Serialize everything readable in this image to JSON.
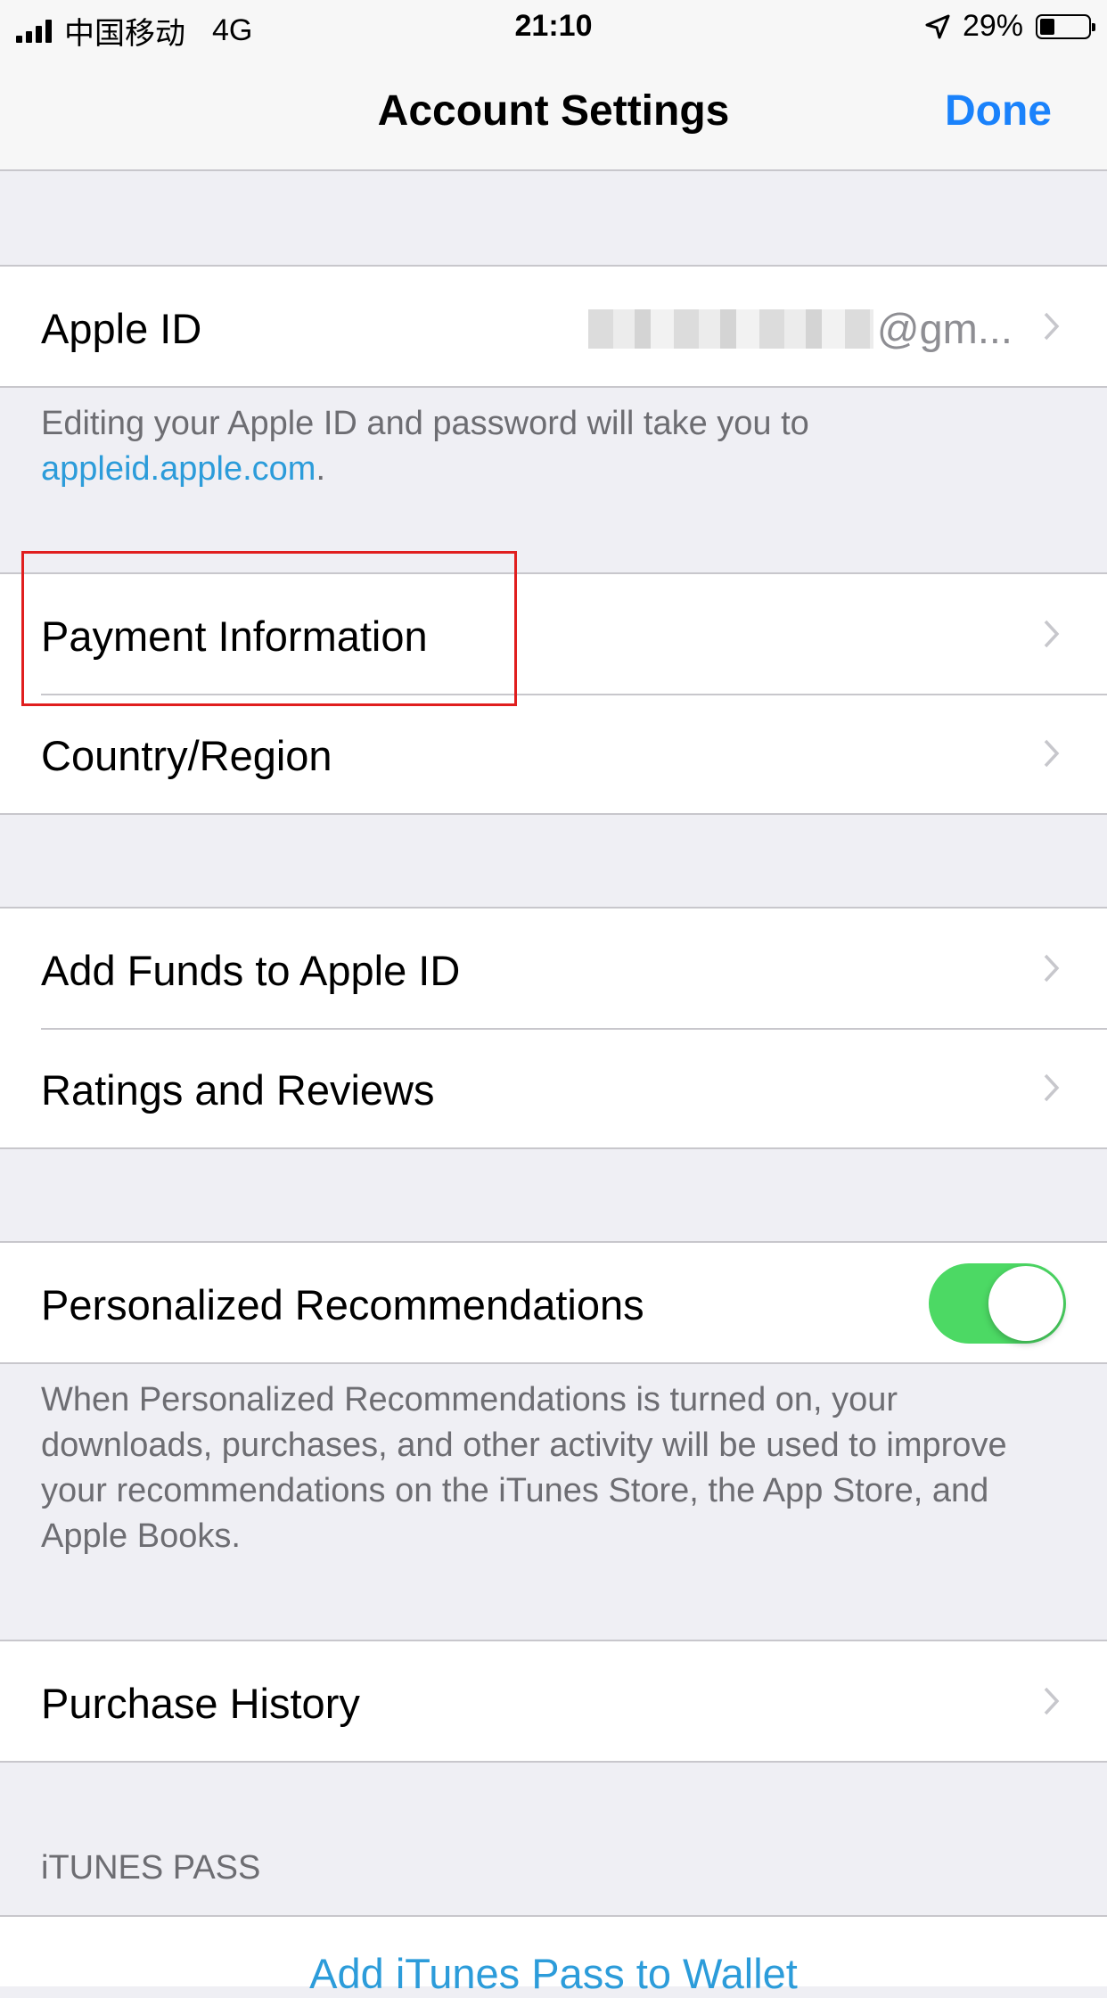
{
  "status_bar": {
    "carrier": "中国移动",
    "network": "4G",
    "time": "21:10",
    "battery": "29%",
    "battery_level": 0.29
  },
  "nav": {
    "title": "Account Settings",
    "done_label": "Done"
  },
  "apple_id": {
    "label": "Apple ID",
    "value_suffix": "@gm..."
  },
  "apple_id_footer": {
    "text": "Editing your Apple ID and password will take you to",
    "link": "appleid.apple.com",
    "end": "."
  },
  "payment_group": [
    "Payment Information",
    "Country/Region"
  ],
  "funds_group": [
    "Add Funds to Apple ID",
    "Ratings and Reviews"
  ],
  "recommendations": {
    "label": "Personalized Recommendations",
    "enabled": true,
    "footer": "When Personalized Recommendations is turned on, your downloads, purchases, and other activity will be used to improve your recommendations on the iTunes Store, the App Store, and Apple Books."
  },
  "history": {
    "label": "Purchase History"
  },
  "itunes_pass": {
    "header": "iTUNES PASS",
    "action": "Add iTunes Pass to Wallet"
  },
  "colors": {
    "accent": "#1a82fb",
    "link": "#2c9cda",
    "toggle_on": "#4cd964",
    "highlight": "#e01e1e"
  }
}
